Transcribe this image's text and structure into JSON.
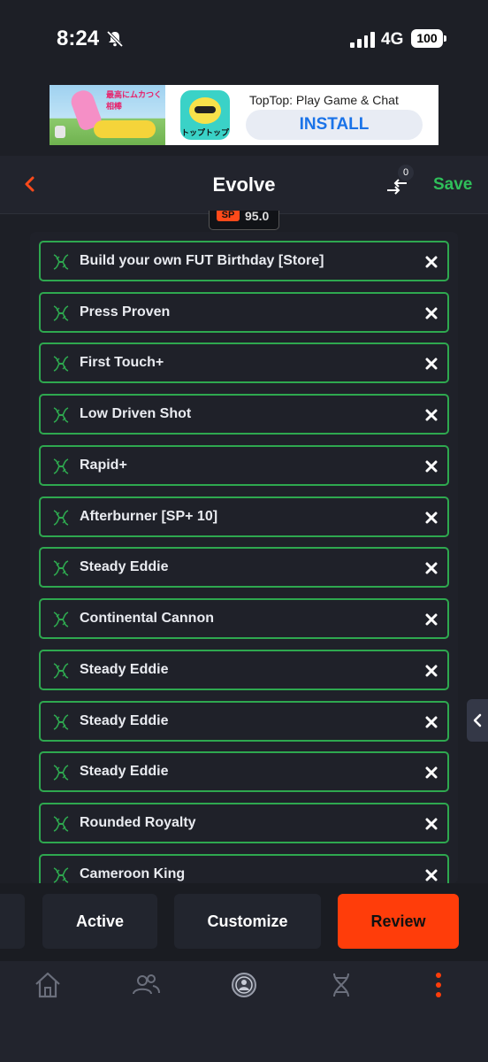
{
  "status_bar": {
    "time": "8:24",
    "network": "4G",
    "battery": "100"
  },
  "ad": {
    "title": "TopTop: Play Game & Chat",
    "install_label": "INSTALL",
    "app_icon_text": "トップトップ",
    "image_text": "最高にムカつく相棒"
  },
  "header": {
    "title": "Evolve",
    "compare_count": "0",
    "save_label": "Save"
  },
  "rating_chip": {
    "tag": "SP",
    "value": "95.0"
  },
  "evolutions": [
    {
      "label": "Build your own FUT Birthday [Store]"
    },
    {
      "label": "Press Proven"
    },
    {
      "label": "First Touch+"
    },
    {
      "label": "Low Driven Shot"
    },
    {
      "label": "Rapid+"
    },
    {
      "label": "Afterburner [SP+ 10]"
    },
    {
      "label": "Steady Eddie"
    },
    {
      "label": "Continental Cannon"
    },
    {
      "label": "Steady Eddie"
    },
    {
      "label": "Steady Eddie"
    },
    {
      "label": "Steady Eddie"
    },
    {
      "label": "Rounded Royalty"
    },
    {
      "label": "Cameroon King"
    }
  ],
  "actions": {
    "active_label": "Active",
    "customize_label": "Customize",
    "review_label": "Review"
  },
  "nav": {
    "items": [
      "home-icon",
      "users-icon",
      "club-icon",
      "dna-icon",
      "more-icon"
    ]
  },
  "colors": {
    "accent_green": "#2fbf5a",
    "accent_orange": "#ff3d0a",
    "background": "#1d1f26"
  }
}
